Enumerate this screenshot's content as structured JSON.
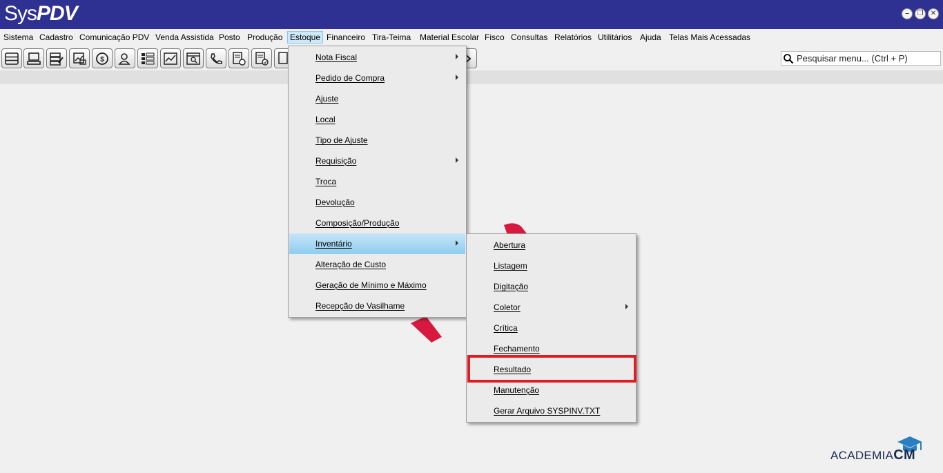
{
  "app": {
    "logo_light": "Sys",
    "logo_bold": "PDV"
  },
  "window_controls": [
    "minimize-icon",
    "restore-icon",
    "close-icon"
  ],
  "menubar": [
    "Sistema",
    "Cadastro",
    "Comunicação PDV",
    "Venda Assistida",
    "Posto",
    "Produção",
    "Estoque",
    "Financeiro",
    "Tira-Teima",
    "Material Escolar",
    "Fisco",
    "Consultas",
    "Relatórios",
    "Utilitários",
    "Ajuda",
    "Telas Mais Acessadas"
  ],
  "active_menu": "Estoque",
  "toolbar_icons": [
    "list-icon",
    "computer-icon",
    "server-edit-icon",
    "document-chart-icon",
    "refresh-money-icon",
    "users-icon",
    "grid-list-icon",
    "chart-icon",
    "window-search-icon",
    "phone-icon",
    "document-add-icon",
    "document-check-icon",
    "documents-icon",
    "arrow-icon"
  ],
  "search": {
    "placeholder": "Pesquisar menu... (Ctrl + P)"
  },
  "estoque_menu": [
    {
      "label": "Nota Fiscal",
      "submenu": true
    },
    {
      "label": "Pedido de Compra",
      "submenu": true
    },
    {
      "label": "Ajuste",
      "submenu": false
    },
    {
      "label": "Local",
      "submenu": false
    },
    {
      "label": "Tipo de Ajuste",
      "submenu": false
    },
    {
      "label": "Requisição",
      "submenu": true
    },
    {
      "label": "Troca",
      "submenu": false
    },
    {
      "label": "Devolução",
      "submenu": false
    },
    {
      "label": "Composição/Produção",
      "submenu": false
    },
    {
      "label": "Inventário",
      "submenu": true,
      "highlighted": true
    },
    {
      "label": "Alteração de Custo",
      "submenu": false
    },
    {
      "label": "Geração de Mínimo e Máximo",
      "submenu": false
    },
    {
      "label": "Recepção de Vasilhame",
      "submenu": false
    }
  ],
  "inventario_menu": [
    {
      "label": "Abertura",
      "submenu": false
    },
    {
      "label": "Listagem",
      "submenu": false
    },
    {
      "label": "Digitação",
      "submenu": false
    },
    {
      "label": "Coletor",
      "submenu": true
    },
    {
      "label": "Crítica",
      "submenu": false
    },
    {
      "label": "Fechamento",
      "submenu": false
    },
    {
      "label": "Resultado",
      "submenu": false,
      "outlined": true
    },
    {
      "label": "Manutenção",
      "submenu": false
    },
    {
      "label": "Gerar Arquivo SYSPINV.TXT",
      "submenu": false
    }
  ],
  "branding": {
    "text": "ACADEMIA",
    "bold": "CM"
  },
  "colors": {
    "titlebar": "#2e3192",
    "highlight": "#8ecdf0",
    "outline": "#e01b22",
    "watermark": "#d7193f"
  }
}
